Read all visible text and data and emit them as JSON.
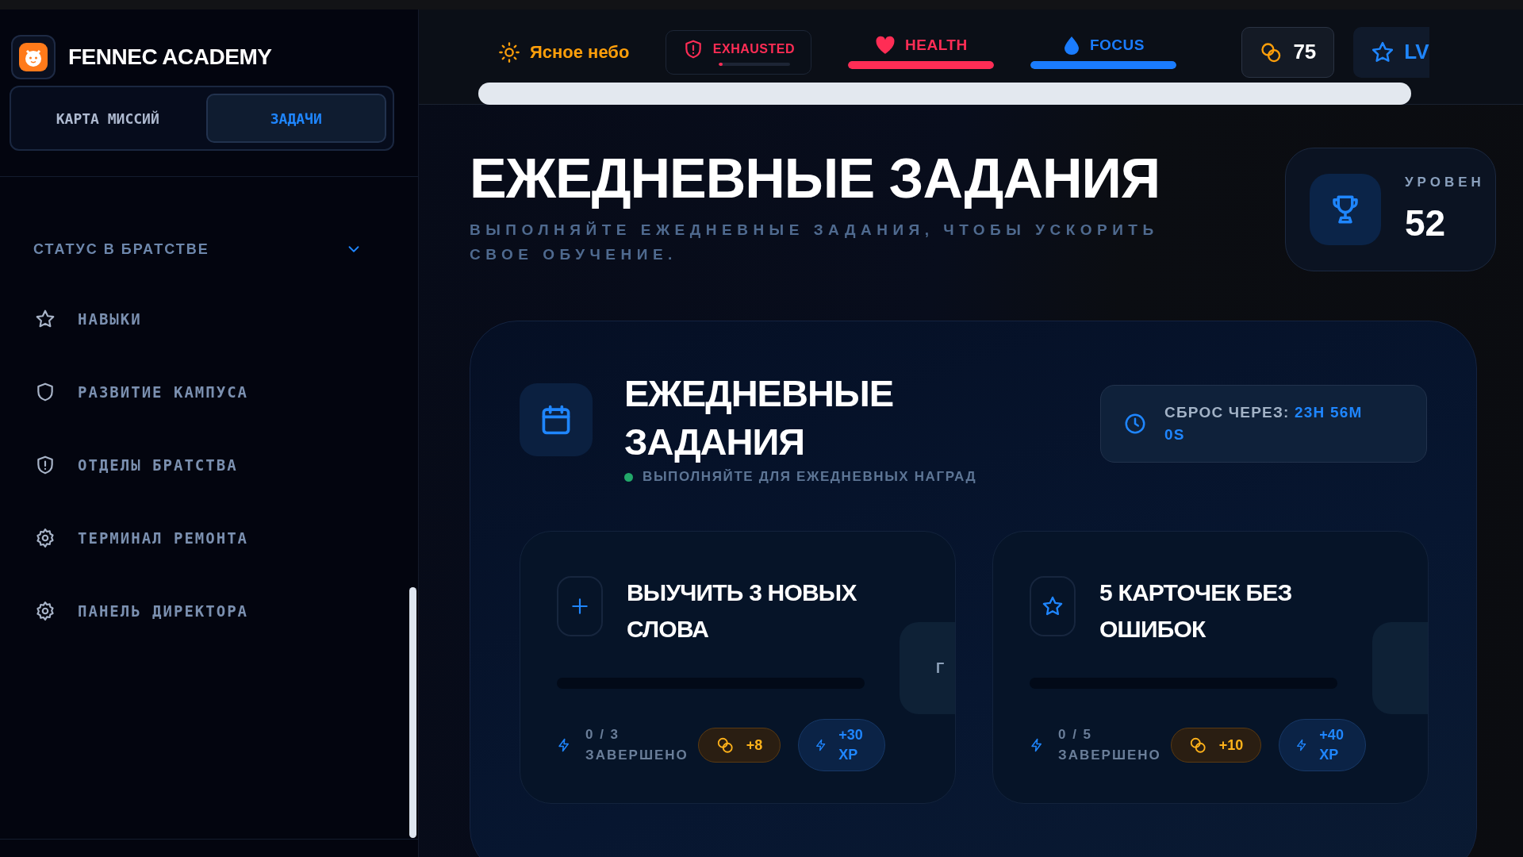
{
  "brand": {
    "name": "FENNEC ACADEMY"
  },
  "mode_tabs": [
    {
      "label": "КАРТА МИССИЙ",
      "selected": false
    },
    {
      "label": "ЗАДАЧИ",
      "selected": true
    }
  ],
  "sidebar": {
    "section": {
      "label": "СТАТУС В БРАТСТВЕ",
      "expanded": true
    },
    "items": [
      {
        "label": "НАВЫКИ",
        "kind": "star"
      },
      {
        "label": "РАЗВИТИЕ КАМПУСА",
        "kind": "shield"
      },
      {
        "label": "ОТДЕЛЫ БРАТСТВА",
        "kind": "alert"
      },
      {
        "label": "ТЕРМИНАЛ РЕМОНТА",
        "kind": "gear"
      },
      {
        "label": "ПАНЕЛЬ ДИРЕКТОРА",
        "kind": "gear"
      }
    ]
  },
  "top_bar": {
    "weather": "Ясное небо",
    "stats": [
      {
        "label": "EXHAUSTED",
        "kind": "boxed",
        "level": 0.05,
        "color": "#ff2d55"
      },
      {
        "label": "HEALTH",
        "kind": "heart",
        "level": 1,
        "color": "#ff2d55"
      },
      {
        "label": "FOCUS",
        "kind": "drop",
        "level": 1,
        "color": "#1a7cff"
      }
    ],
    "coins": "75",
    "level_label": "LV"
  },
  "page": {
    "title": "ЕЖЕДНЕВНЫЕ ЗАДАНИЯ",
    "subtitle": "ВЫПОЛНЯЙТЕ ЕЖЕДНЕВНЫЕ ЗАДАНИЯ, ЧТОБЫ УСКОРИТЬ СВОЕ ОБУЧЕНИЕ.",
    "level_card": {
      "label": "УРОВЕН",
      "value": "52"
    }
  },
  "daily": {
    "title": "ЕЖЕДНЕВНЫЕ ЗАДАНИЯ",
    "hint": "ВЫПОЛНЯЙТЕ ДЛЯ ЕЖЕДНЕВНЫХ НАГРАД",
    "reset_label": "СБРОС ЧЕРЕЗ:",
    "reset_time": "23H 56M 0S",
    "tasks": [
      {
        "title": "ВЫУЧИТЬ 3 НОВЫХ СЛОВА",
        "kind": "plus",
        "level": 0,
        "progress": "0 / 3",
        "status": "ЗАВЕРШЕНО",
        "coins": "+8",
        "xp": "+30 XP",
        "side_button": "Г"
      },
      {
        "title": "5 КАРТОЧЕК БЕЗ ОШИБОК",
        "kind": "star",
        "level": 0,
        "progress": "0 / 5",
        "status": "ЗАВЕРШЕНО",
        "coins": "+10",
        "xp": "+40 XP"
      }
    ]
  }
}
